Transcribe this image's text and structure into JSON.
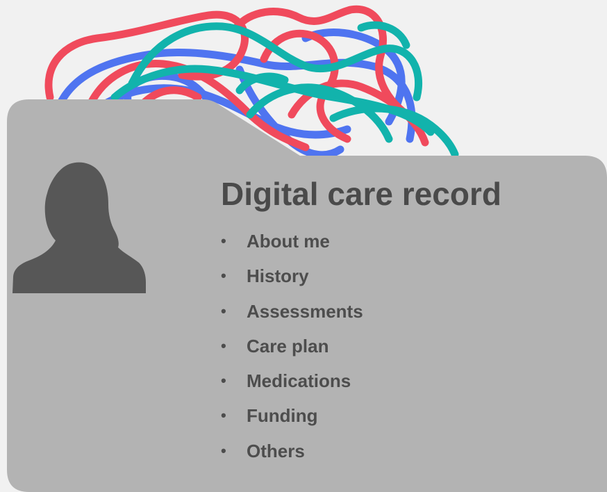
{
  "record": {
    "title": "Digital care record",
    "bullet": "•",
    "sections": [
      {
        "label": "About me"
      },
      {
        "label": "History"
      },
      {
        "label": "Assessments"
      },
      {
        "label": "Care plan"
      },
      {
        "label": "Medications"
      },
      {
        "label": "Funding"
      },
      {
        "label": "Others"
      }
    ]
  },
  "colors": {
    "background": "#f1f1f1",
    "folder": "#b3b3b3",
    "text": "#4a4a4a",
    "avatar": "#575757",
    "scribble_red": "#f04a5c",
    "scribble_blue": "#4f74f0",
    "scribble_teal": "#12b3ac"
  },
  "icons": {
    "avatar": "person-silhouette-icon",
    "scribble": "tangled-lines-illustration"
  }
}
